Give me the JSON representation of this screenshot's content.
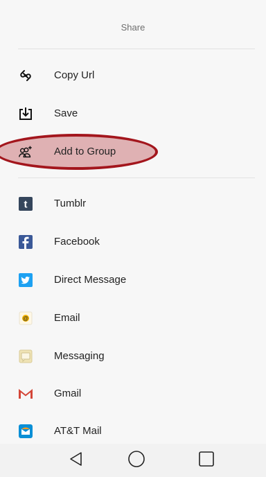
{
  "sheet": {
    "title": "Share",
    "top_actions": [
      {
        "name": "copy-url",
        "label": "Copy Url",
        "icon": "link-icon"
      },
      {
        "name": "save",
        "label": "Save",
        "icon": "download-icon"
      },
      {
        "name": "add-to-group",
        "label": "Add to Group",
        "icon": "add-group-icon"
      }
    ],
    "apps": [
      {
        "name": "tumblr",
        "label": "Tumblr",
        "icon": "tumblr-icon"
      },
      {
        "name": "facebook",
        "label": "Facebook",
        "icon": "facebook-icon"
      },
      {
        "name": "direct-message",
        "label": "Direct Message",
        "icon": "twitter-icon"
      },
      {
        "name": "email",
        "label": "Email",
        "icon": "email-icon"
      },
      {
        "name": "messaging",
        "label": "Messaging",
        "icon": "messaging-icon"
      },
      {
        "name": "gmail",
        "label": "Gmail",
        "icon": "gmail-icon"
      },
      {
        "name": "att-mail",
        "label": "AT&T Mail",
        "icon": "att-mail-icon"
      }
    ]
  },
  "nav": {
    "back": "back-triangle-icon",
    "home": "home-circle-icon",
    "recents": "recents-square-icon"
  },
  "colors": {
    "highlight_stroke": "#a3161d",
    "tumblr": "#35465c",
    "facebook": "#3b5998",
    "twitter": "#1da1f2",
    "gmail": "#d44638"
  }
}
